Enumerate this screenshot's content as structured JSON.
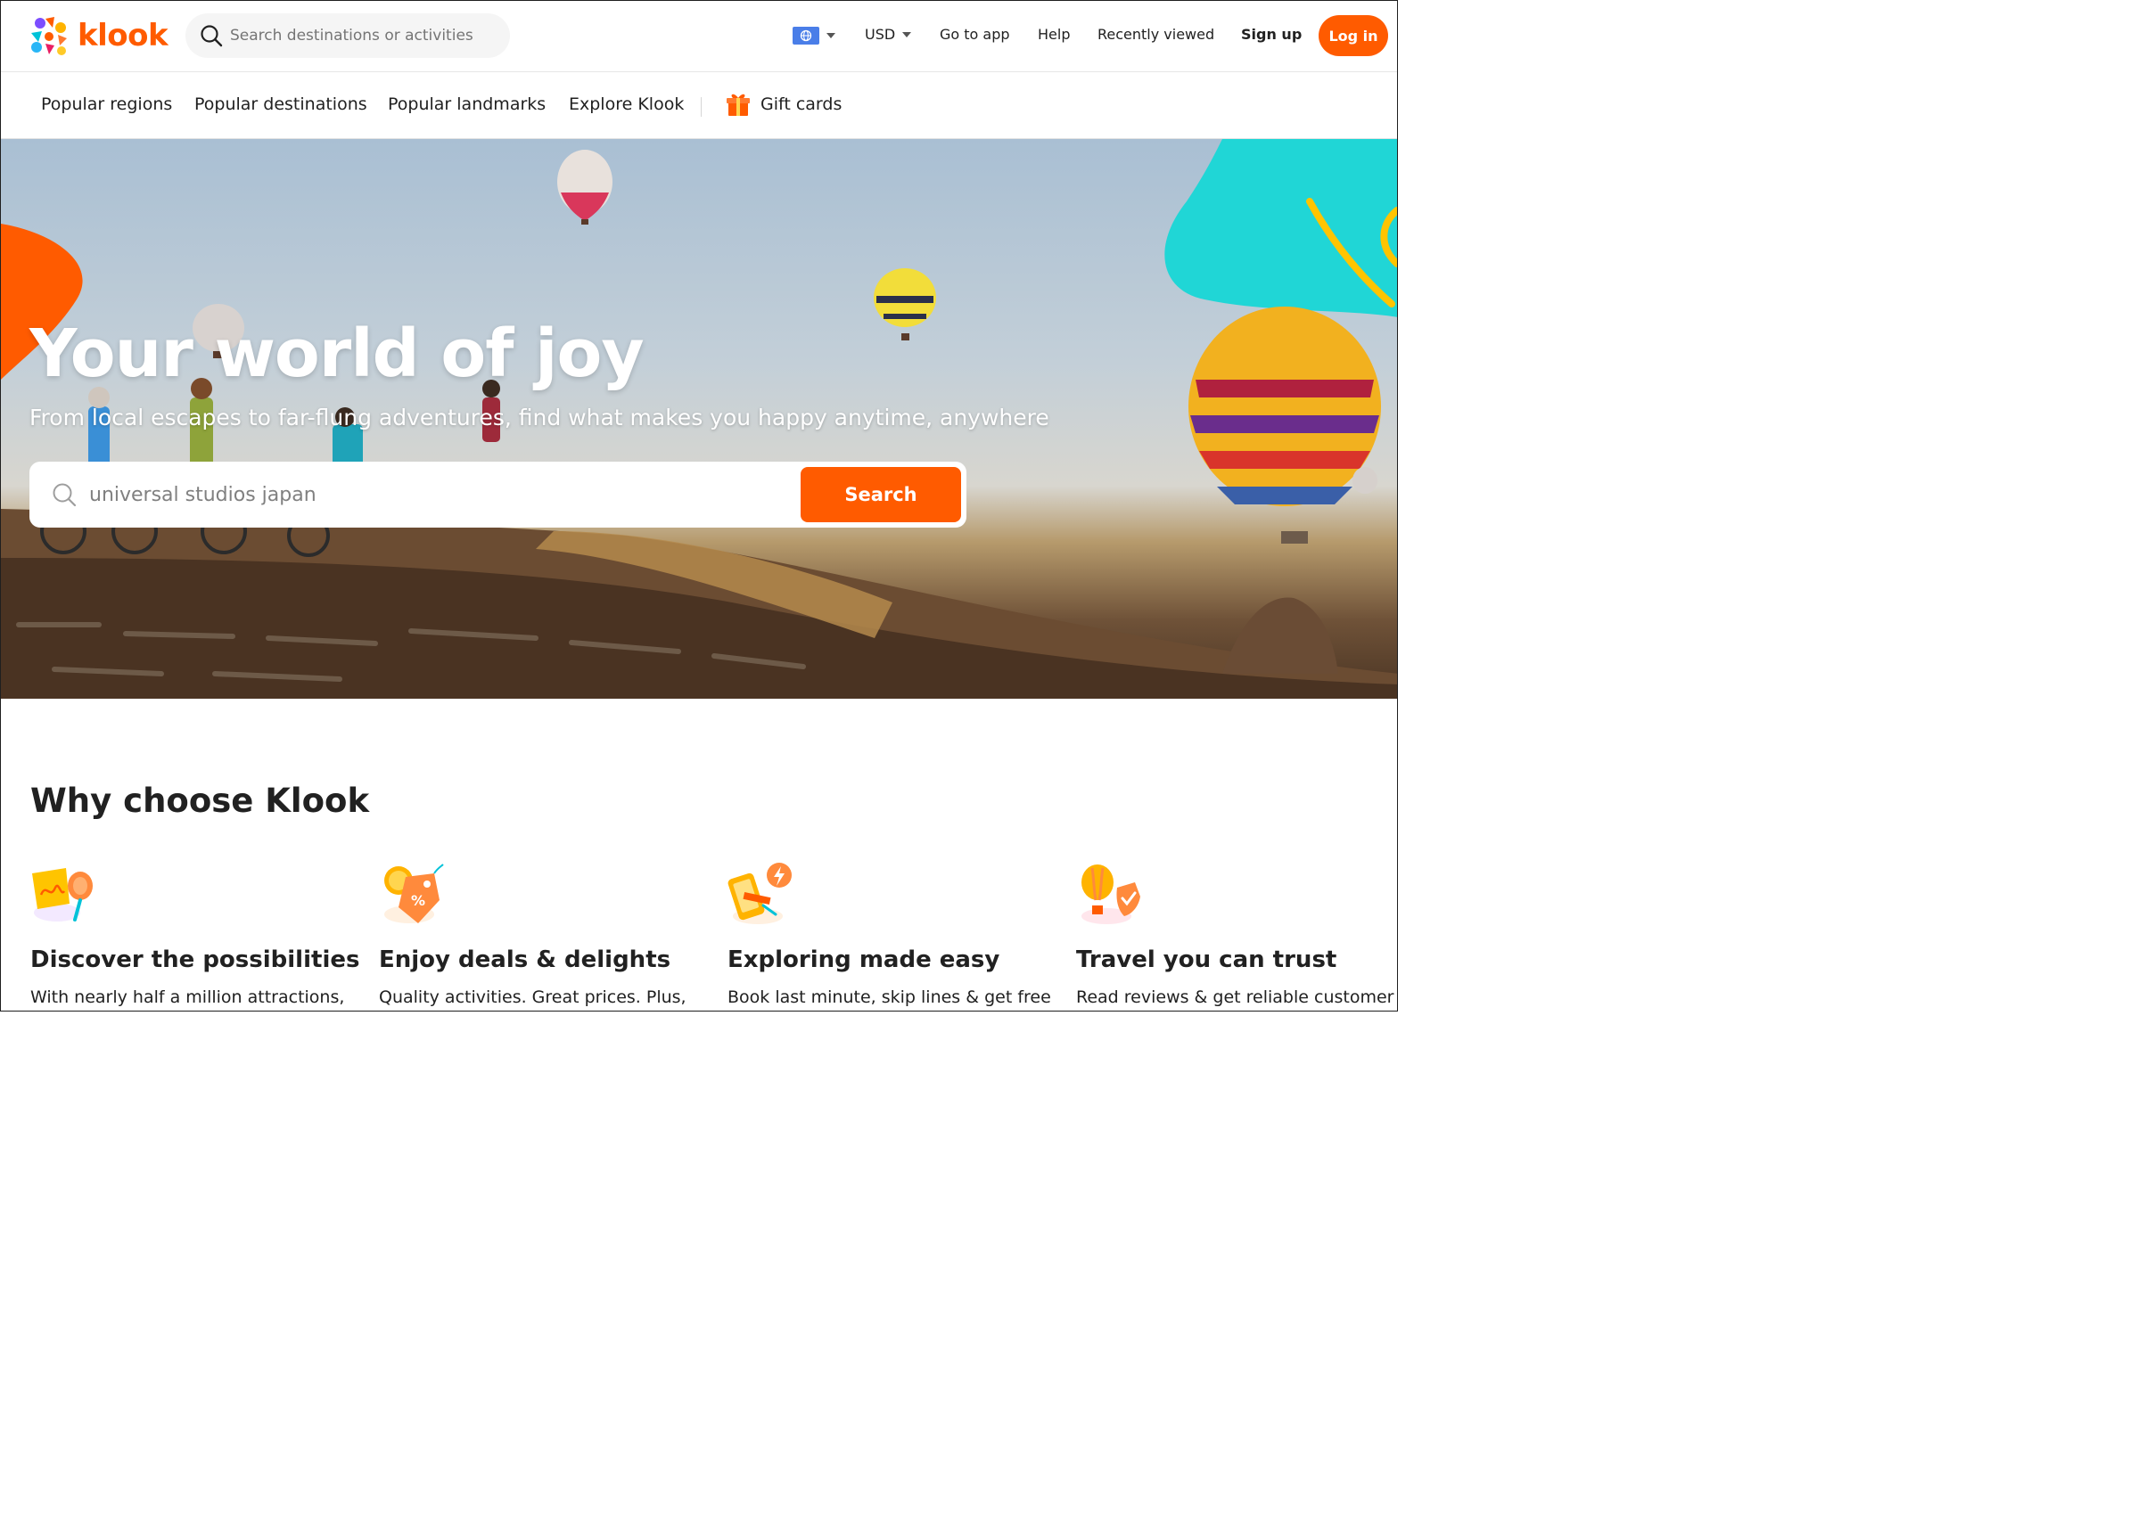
{
  "brand": {
    "name": "klook",
    "accent": "#ff5b00"
  },
  "header": {
    "search_placeholder": "Search destinations or activities",
    "currency": "USD",
    "links": {
      "go_to_app": "Go to app",
      "help": "Help",
      "recently_viewed": "Recently viewed",
      "sign_up": "Sign up"
    },
    "login_label": "Log in"
  },
  "subnav": {
    "items": [
      "Popular regions",
      "Popular destinations",
      "Popular landmarks",
      "Explore Klook"
    ],
    "gift_cards": "Gift cards"
  },
  "hero": {
    "title": "Your world of joy",
    "subtitle": "From local escapes to far-flung adventures, find what makes you happy anytime, anywhere",
    "search_placeholder": "universal studios japan",
    "search_button": "Search"
  },
  "why": {
    "title": "Why choose Klook",
    "features": [
      {
        "icon": "map-pin-icon",
        "title": "Discover the possibilities",
        "text": "With nearly half a million attractions,"
      },
      {
        "icon": "discount-tag-icon",
        "title": "Enjoy deals & delights",
        "text": "Quality activities. Great prices. Plus,"
      },
      {
        "icon": "mobile-booking-icon",
        "title": "Exploring made easy",
        "text": "Book last minute, skip lines & get free"
      },
      {
        "icon": "balloon-shield-icon",
        "title": "Travel you can trust",
        "text": "Read reviews & get reliable customer"
      }
    ]
  }
}
